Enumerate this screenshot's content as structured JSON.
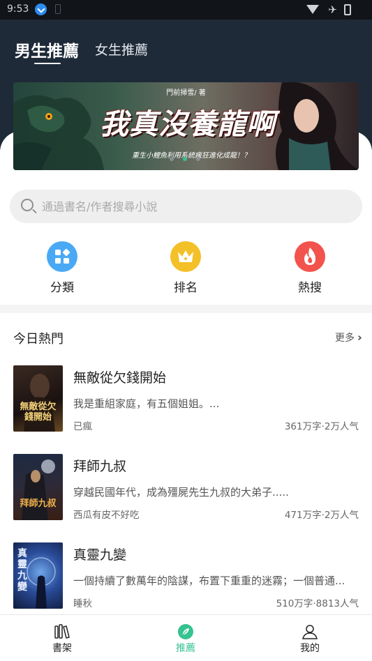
{
  "status_bar": {
    "time": "9:53"
  },
  "header": {
    "tabs": [
      {
        "label": "男生推薦",
        "active": true
      },
      {
        "label": "女生推薦",
        "active": false
      }
    ]
  },
  "banner": {
    "author": "門前掃雪/ 著",
    "title": "我真沒養龍啊",
    "subtitle": "重生小鯉魚利用系統瘋狂進化成龍！？",
    "page_count": 3,
    "active_index": 1
  },
  "search": {
    "placeholder": "通過書名/作者搜尋小說",
    "value": ""
  },
  "quick_entries": [
    {
      "label": "分類",
      "icon": "category-icon",
      "color": "#4aa9f5"
    },
    {
      "label": "排名",
      "icon": "crown-icon",
      "color": "#f4c028"
    },
    {
      "label": "熱搜",
      "icon": "flame-icon",
      "color": "#f2534c"
    }
  ],
  "today_hot": {
    "title": "今日熱門",
    "more_label": "更多",
    "books": [
      {
        "title": "無敵從欠錢開始",
        "cover_text": "無敵從欠錢開始",
        "desc": "我是重組家庭，有五個姐姐。...",
        "author": "已瘋",
        "meta": "361万字·2万人气"
      },
      {
        "title": "拜師九叔",
        "cover_text": "拜師九叔",
        "desc": "穿越民國年代，成為殭屍先生九叔的大弟子.....",
        "author": "西瓜有皮不好吃",
        "meta": "471万字·2万人气"
      },
      {
        "title": "真靈九變",
        "cover_text": "真靈九變",
        "desc": "一個持續了數萬年的陰謀，布置下重重的迷霧；一個普通...",
        "author": "睡秋",
        "meta": "510万字·8813人气"
      }
    ]
  },
  "bottom_nav": [
    {
      "label": "書架",
      "icon": "bookshelf-icon",
      "active": false
    },
    {
      "label": "推薦",
      "icon": "recommend-leaf-icon",
      "active": true
    },
    {
      "label": "我的",
      "icon": "profile-icon",
      "active": false
    }
  ],
  "colors": {
    "accent": "#36c291",
    "header_bg": "#1e2a38"
  }
}
